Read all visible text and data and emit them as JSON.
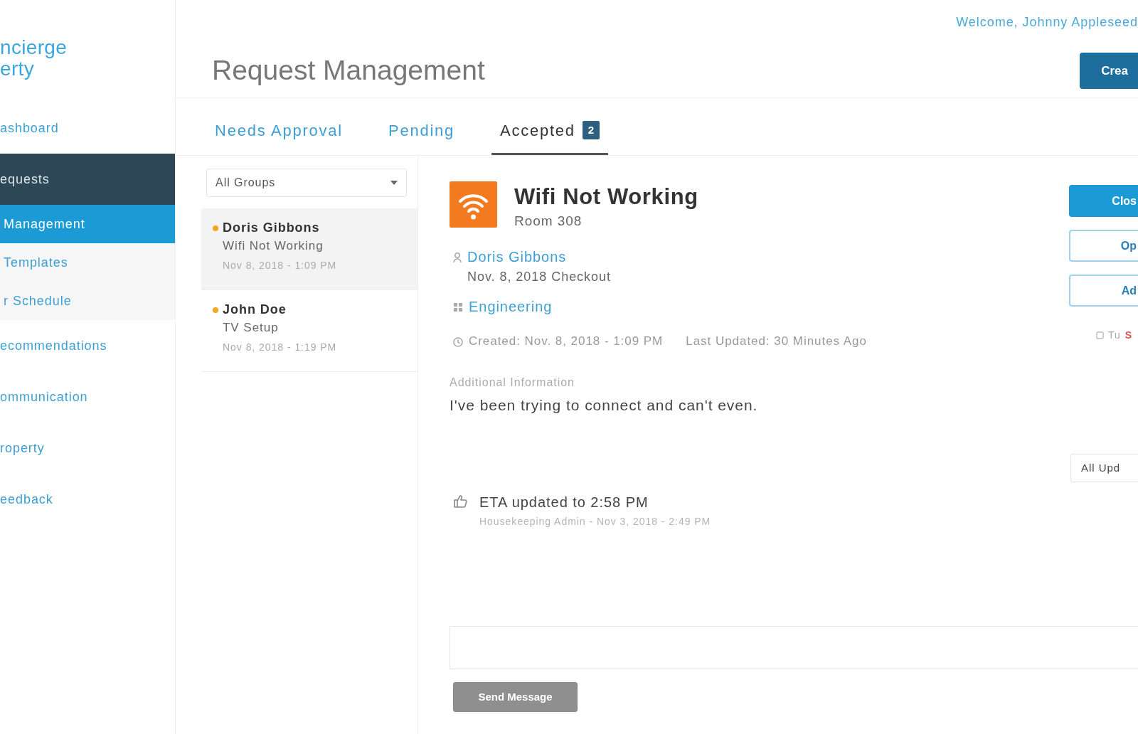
{
  "sidebar": {
    "logo": [
      "ncierge",
      "erty"
    ],
    "items": [
      {
        "label": "ashboard",
        "kind": "link",
        "selected": false
      },
      {
        "label": "equests",
        "kind": "group",
        "selected": false,
        "expanded": true,
        "children": [
          {
            "label": "Management",
            "selected": true
          },
          {
            "label": "Templates",
            "selected": false
          },
          {
            "label": "r Schedule",
            "selected": false
          }
        ]
      },
      {
        "label": "ecommendations",
        "kind": "link",
        "selected": false
      },
      {
        "label": "ommunication",
        "kind": "link",
        "selected": false
      },
      {
        "label": "roperty",
        "kind": "link",
        "selected": false
      },
      {
        "label": "eedback",
        "kind": "link",
        "selected": false
      }
    ]
  },
  "header": {
    "welcome": "Welcome, Johnny Appleseed",
    "title": "Request Management",
    "create_button": "Crea"
  },
  "tabs": [
    {
      "label": "Needs Approval",
      "selected": false
    },
    {
      "label": "Pending",
      "selected": false
    },
    {
      "label": "Accepted",
      "selected": true,
      "badge": "2"
    }
  ],
  "request_list": {
    "filter": "All Groups",
    "items": [
      {
        "name": "Doris Gibbons",
        "subject": "Wifi Not Working",
        "date": "Nov 8, 2018 - 1:09 PM",
        "selected": true
      },
      {
        "name": "John Doe",
        "subject": "TV Setup",
        "date": "Nov 8, 2018 - 1:19 PM",
        "selected": false
      }
    ]
  },
  "detail": {
    "title": "Wifi Not Working",
    "location": "Room 308",
    "guest": "Doris Gibbons",
    "stay": "Nov. 8, 2018 Checkout",
    "department": "Engineering",
    "created": "Created: Nov. 8, 2018 - 1:09 PM",
    "updated": "Last Updated: 30 Minutes Ago",
    "info_label": "Additional Information",
    "info_text": "I've been trying to connect and can't even.",
    "actions": [
      {
        "label": "Clos",
        "kind": "primary"
      },
      {
        "label": "Op",
        "kind": "outline"
      },
      {
        "label": "Ad",
        "kind": "outline"
      }
    ],
    "status_row": {
      "text": "Tu",
      "alert": "S"
    },
    "updates_filter": "All Upd",
    "updates": [
      {
        "text": "ETA updated to 2:58 PM",
        "meta": "Housekeeping Admin - Nov 3, 2018 - 2:49 PM"
      }
    ],
    "send_button": {
      "label": "Send Message",
      "disabled": true
    }
  }
}
